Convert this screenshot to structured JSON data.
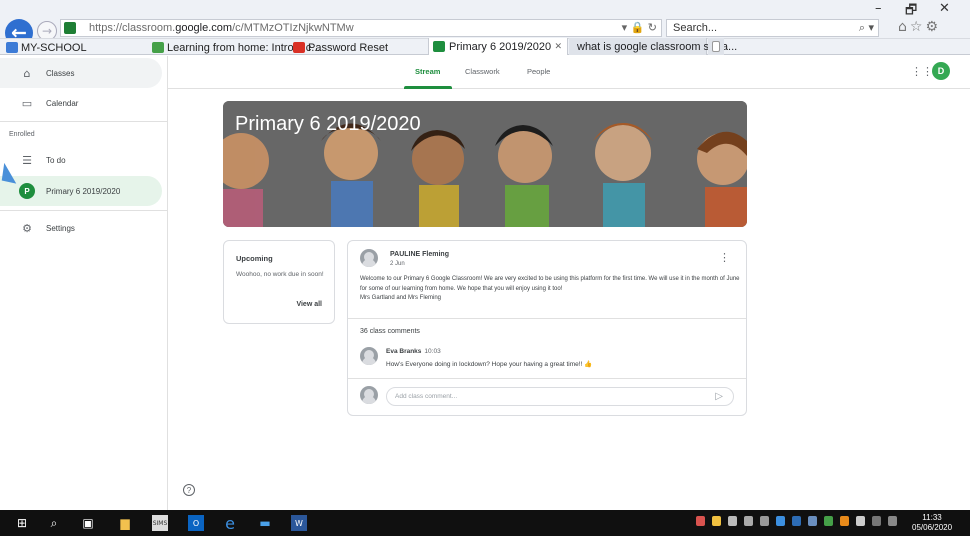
{
  "browser": {
    "address": {
      "prefix": "https://classroom.",
      "domain": "google.com",
      "path": "/c/MTMzOTIzNjkwNTMw",
      "icons": "▾ 🔒 ↻"
    },
    "search": {
      "placeholder": "Search...",
      "dropdown": "⌕ ▾"
    },
    "window_controls": {
      "minimize": "–",
      "maximize": "🗗",
      "close": "✕"
    },
    "favorites": [
      {
        "label": "MY-SCHOOL",
        "color": "#3d7bd6"
      },
      {
        "label": "Learning from home: Introduc...",
        "color": "#45a048"
      },
      {
        "label": "Password Reset",
        "color": "#d93025"
      }
    ],
    "tabs": [
      {
        "label": "Primary 6 2019/2020",
        "close": "✕",
        "color": "#1e8e3e"
      },
      {
        "label": "what is google classroom strea...",
        "color": "#4285f4"
      }
    ]
  },
  "sidebar": {
    "items": [
      {
        "label": "Classes",
        "icon": "home-icon"
      },
      {
        "label": "Calendar",
        "icon": "calendar-icon"
      }
    ],
    "section_label": "Enrolled",
    "enrolled": [
      {
        "label": "To do",
        "icon": "todo-icon"
      },
      {
        "label": "Primary 6 2019/2020",
        "badge": "P"
      }
    ],
    "settings_label": "Settings"
  },
  "topnav": {
    "tabs": [
      "Stream",
      "Classwork",
      "People"
    ],
    "active": "Stream",
    "avatar": "D"
  },
  "banner": {
    "title": "Primary 6 2019/2020"
  },
  "upcoming": {
    "title": "Upcoming",
    "text": "Woohoo, no work due in soon!",
    "link": "View all"
  },
  "post": {
    "author": "PAULINE Fleming",
    "date": "2 Jun",
    "body": "Welcome to our Primary 6 Google Classroom! We are very excited to be using this platform for the first time. We will use it in the month of June for some of our learning from home. We hope that you will enjoy using it too!",
    "signoff": "Mrs Gartland and Mrs Fleming",
    "comment_count": "36 class comments",
    "comment": {
      "author": "Eva Branks",
      "time": "10:03",
      "text": "How's Everyone doing in lockdown? Hope your having a great time!! 👍"
    },
    "comment_placeholder": "Add class comment..."
  },
  "help": "?",
  "taskbar": {
    "time": "11:33",
    "date": "05/06/2020"
  }
}
